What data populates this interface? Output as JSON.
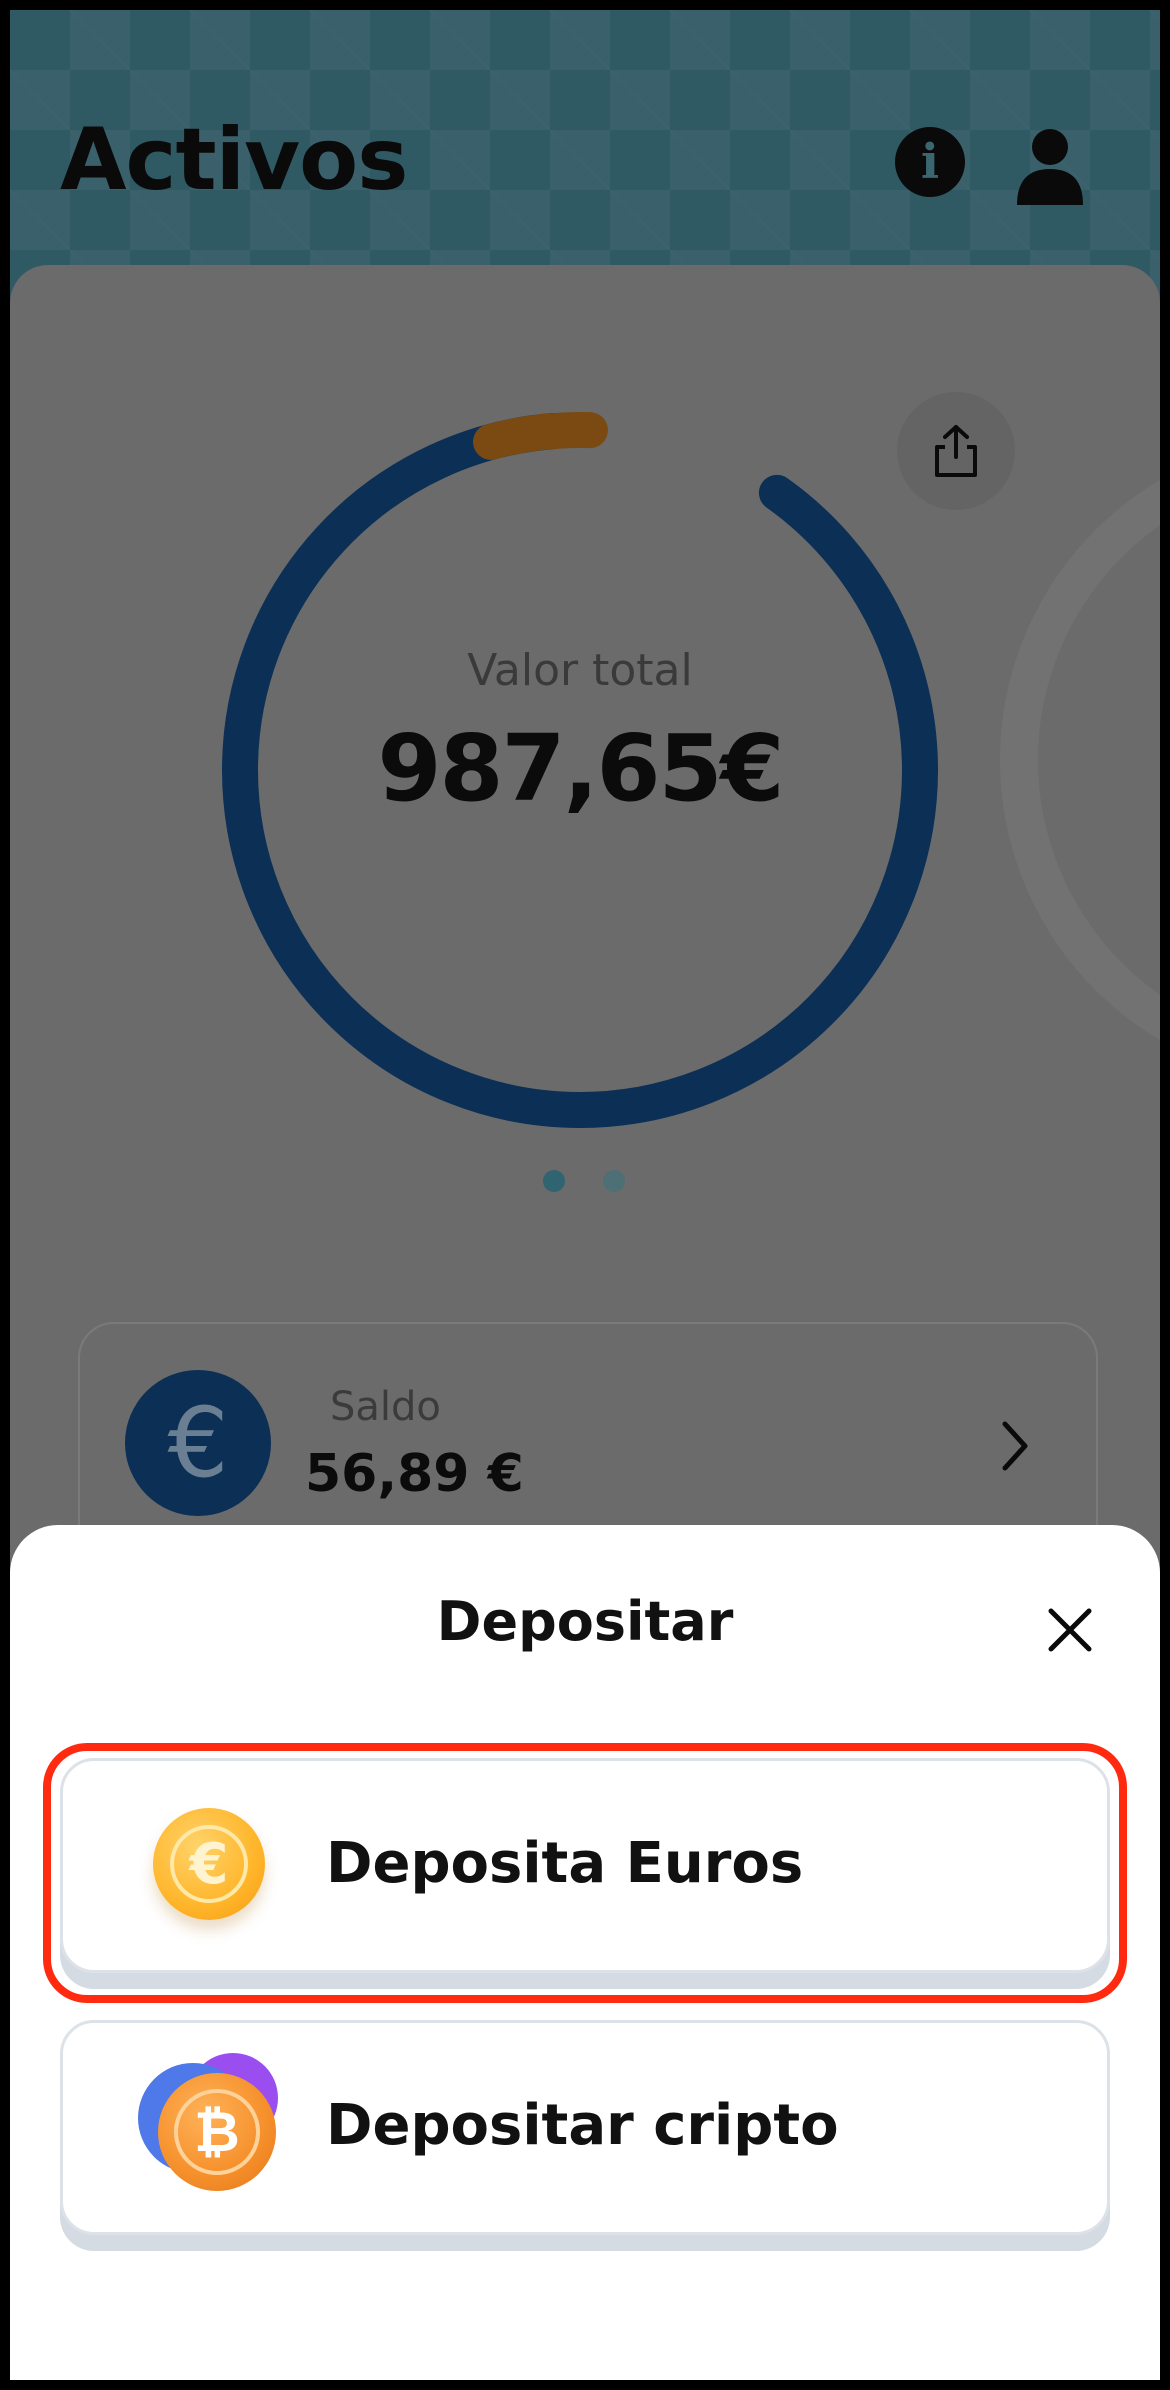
{
  "header": {
    "title": "Activos",
    "info_icon": "i"
  },
  "portfolio": {
    "total_label": "Valor total",
    "total_value": "987,65€",
    "carousel_pages": 2,
    "carousel_active": 1
  },
  "balance": {
    "currency_symbol": "€",
    "label": "Saldo",
    "value": "56,89 €"
  },
  "sheet": {
    "title": "Depositar",
    "options": [
      {
        "label": "Deposita Euros",
        "icon": "euro-coin-icon",
        "coin_symbol": "€"
      },
      {
        "label": "Depositar cripto",
        "icon": "bitcoin-coins-icon",
        "coin_symbol": "₿"
      }
    ]
  },
  "colors": {
    "header_bg": "#2f5963",
    "donut_primary": "#0b2f55",
    "donut_secondary": "#7a4a12",
    "highlight": "#ff2a10"
  }
}
